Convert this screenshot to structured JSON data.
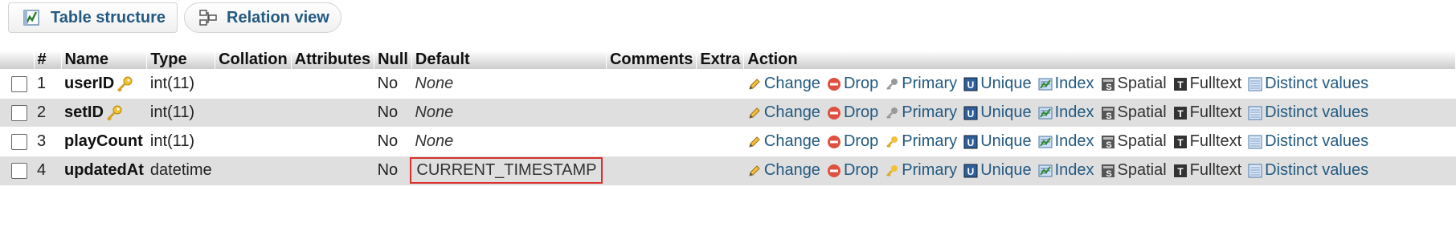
{
  "tabs": [
    {
      "label": "Table structure",
      "icon": "table-structure-icon"
    },
    {
      "label": "Relation view",
      "icon": "relation-view-icon"
    }
  ],
  "table": {
    "columns": [
      "#",
      "Name",
      "Type",
      "Collation",
      "Attributes",
      "Null",
      "Default",
      "Comments",
      "Extra",
      "Action"
    ],
    "rows": [
      {
        "num": "1",
        "name": "userID",
        "type": "int(11)",
        "null": "No",
        "default": "None",
        "primary_key": true
      },
      {
        "num": "2",
        "name": "setID",
        "type": "int(11)",
        "null": "No",
        "default": "None",
        "primary_key": true
      },
      {
        "num": "3",
        "name": "playCount",
        "type": "int(11)",
        "null": "No",
        "default": "None",
        "primary_key": false
      },
      {
        "num": "4",
        "name": "updatedAt",
        "type": "datetime",
        "null": "No",
        "default": "CURRENT_TIMESTAMP",
        "primary_key": false,
        "highlighted": true
      }
    ],
    "actions": {
      "change": "Change",
      "drop": "Drop",
      "primary": "Primary",
      "unique": "Unique",
      "index": "Index",
      "spatial": "Spatial",
      "fulltext": "Fulltext",
      "distinct": "Distinct values"
    }
  },
  "colors": {
    "link": "#235a81",
    "highlight_border": "#d9302c",
    "row_alt": "#dfdfdf"
  }
}
